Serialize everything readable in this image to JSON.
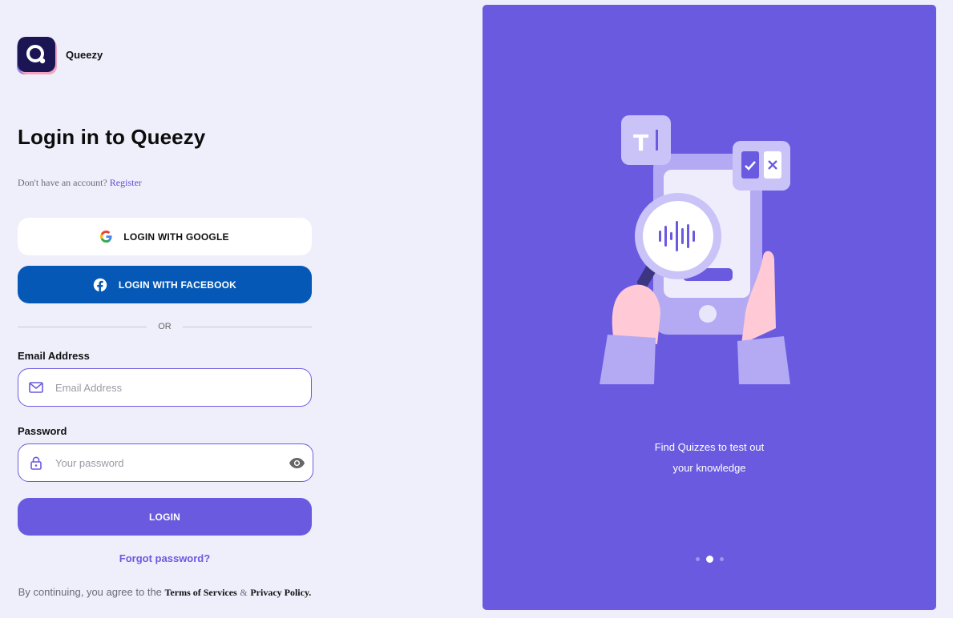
{
  "brand": {
    "name": "Queezy"
  },
  "heading": "Login in to Queezy",
  "register": {
    "prompt": "Don't have an account?",
    "link": "Register"
  },
  "social": {
    "google_label": "LOGIN WITH GOOGLE",
    "facebook_label": "LOGIN WITH FACEBOOK"
  },
  "divider": "OR",
  "email": {
    "label": "Email Address",
    "placeholder": "Email Address",
    "value": ""
  },
  "password": {
    "label": "Password",
    "placeholder": "Your password",
    "value": ""
  },
  "login_label": "LOGIN",
  "forgot": "Forgot password?",
  "terms": {
    "prefix": "By continuing, you agree to the",
    "tos": "Terms of Services",
    "amp": "&",
    "privacy": "Privacy Policy."
  },
  "panel": {
    "caption_line1": "Find Quizzes to test out",
    "caption_line2": "your knowledge"
  },
  "carousel": {
    "slides": 3,
    "active": 2
  },
  "colors": {
    "primary": "#6a5ae0",
    "facebook": "#0558b5",
    "background": "#efeefb",
    "logo_bg": "#1b1653"
  }
}
